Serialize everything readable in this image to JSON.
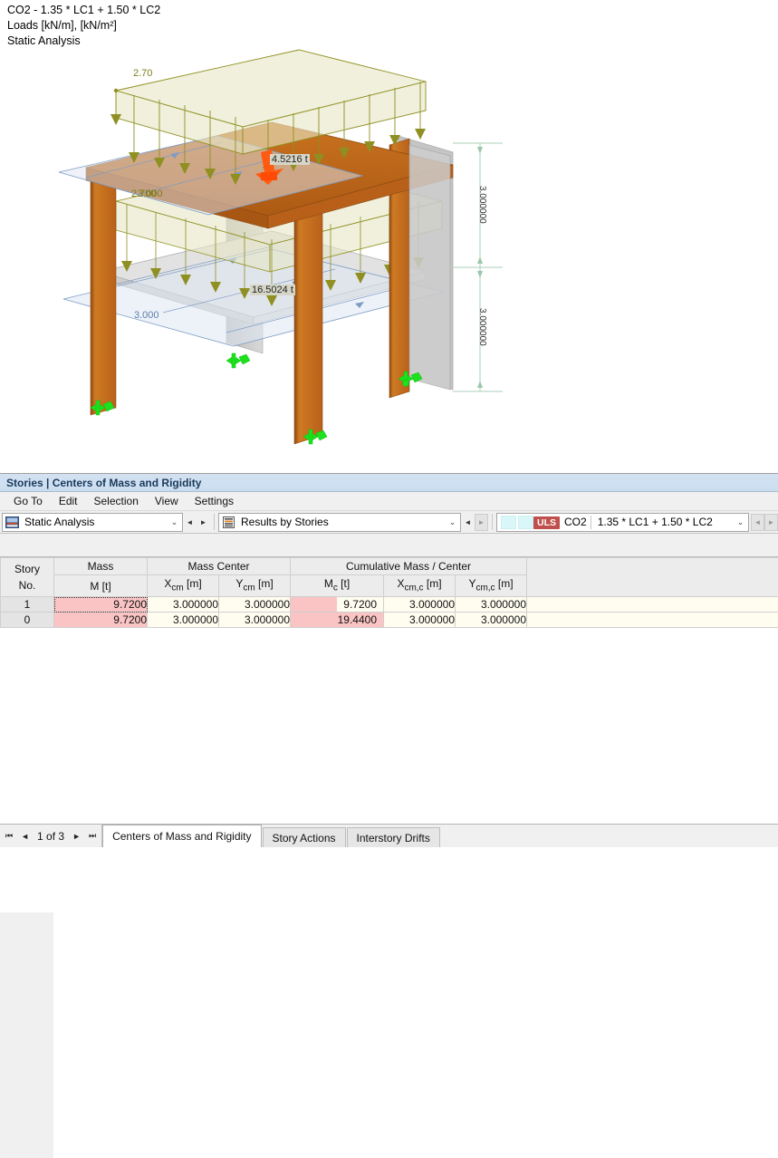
{
  "viewport": {
    "caption_lines": [
      "CO2 - 1.35 * LC1 + 1.50 * LC2",
      "Loads [kN/m], [kN/m²]",
      "Static Analysis"
    ],
    "labels": {
      "load_top": "2.70",
      "load_mid": "2.700",
      "load_mid2": "3.000",
      "load_low": "3.000",
      "force_top": "4.5216 t",
      "force_low": "16.5024 t",
      "dim_upper": "3.000000",
      "dim_lower": "3.000000"
    },
    "colors": {
      "slab": "#c1681f",
      "wall": "#c9c9c9",
      "load_fill": "#e3e3c4",
      "load_line": "#9a9a2a",
      "blue_plane": "#dbe5f2",
      "blue_line": "#7e9cc4",
      "support": "#22dd22",
      "force_arrow": "#ff4d0d",
      "dim_line": "#b9d5c3"
    }
  },
  "panel": {
    "title": "Stories | Centers of Mass and Rigidity",
    "menu": [
      "Go To",
      "Edit",
      "Selection",
      "View",
      "Settings"
    ],
    "toolbar": {
      "analysis_icon": "static-analysis-icon",
      "analysis_value": "Static Analysis",
      "results_icon": "results-by-stories-icon",
      "results_value": "Results by Stories",
      "case_badge": "ULS",
      "case_code": "CO2",
      "case_formula": "1.35 * LC1 + 1.50 * LC2",
      "caret_glyph": "⌄",
      "prev_glyph": "◄",
      "next_glyph": "►"
    }
  },
  "table": {
    "group_headers": [
      {
        "label": "",
        "span": 1
      },
      {
        "label": "Mass",
        "span": 1
      },
      {
        "label": "Mass Center",
        "span": 2
      },
      {
        "label": "Cumulative Mass / Center",
        "span": 3
      },
      {
        "label": "",
        "span": 1
      }
    ],
    "sub_headers": [
      {
        "top": "Story",
        "bottom": "No."
      },
      {
        "top": "Mass",
        "bottom": "M [t]"
      },
      {
        "top": "",
        "bottom": "Xₑₘ [m]"
      },
      {
        "top": "",
        "bottom": "Yₑₘ [m]"
      },
      {
        "top": "",
        "bottom": "Mₑ [t]"
      },
      {
        "top": "",
        "bottom": "Xₑₘ,ₑ [m]"
      },
      {
        "top": "",
        "bottom": "Yₑₘ,ₑ [m]"
      },
      {
        "top": "",
        "bottom": ""
      }
    ],
    "header_labels": {
      "story_no_1": "Story",
      "story_no_2": "No.",
      "mass_1": "Mass",
      "mass_2": "M [t]",
      "masscenter": "Mass Center",
      "xcm": "X",
      "xcm_sub": "cm",
      "xcm_unit": " [m]",
      "ycm": "Y",
      "ycm_sub": "cm",
      "ycm_unit": " [m]",
      "cumulative": "Cumulative Mass / Center",
      "mc": "M",
      "mc_sub": "c",
      "mc_unit": " [t]",
      "xcmc": "X",
      "xcmc_sub": "cm,c",
      "xcmc_unit": " [m]",
      "ycmc": "Y",
      "ycmc_sub": "cm,c",
      "ycmc_unit": " [m]"
    },
    "rows": [
      {
        "story": "1",
        "mass": "9.7200",
        "xcm": "3.000000",
        "ycm": "3.000000",
        "mc": "9.7200",
        "mc_bar_pct": 50,
        "xcmc": "3.000000",
        "ycmc": "3.000000",
        "selected": true
      },
      {
        "story": "0",
        "mass": "9.7200",
        "xcm": "3.000000",
        "ycm": "3.000000",
        "mc": "19.4400",
        "mc_bar_pct": 100,
        "xcmc": "3.000000",
        "ycmc": "3.000000",
        "selected": false
      }
    ]
  },
  "footer": {
    "first_glyph": "⏮",
    "prev_glyph": "◄",
    "page_text": "1 of 3",
    "next_glyph": "►",
    "last_glyph": "⏭",
    "tabs": [
      {
        "label": "Centers of Mass and Rigidity",
        "active": true
      },
      {
        "label": "Story Actions",
        "active": false
      },
      {
        "label": "Interstory Drifts",
        "active": false
      }
    ]
  }
}
